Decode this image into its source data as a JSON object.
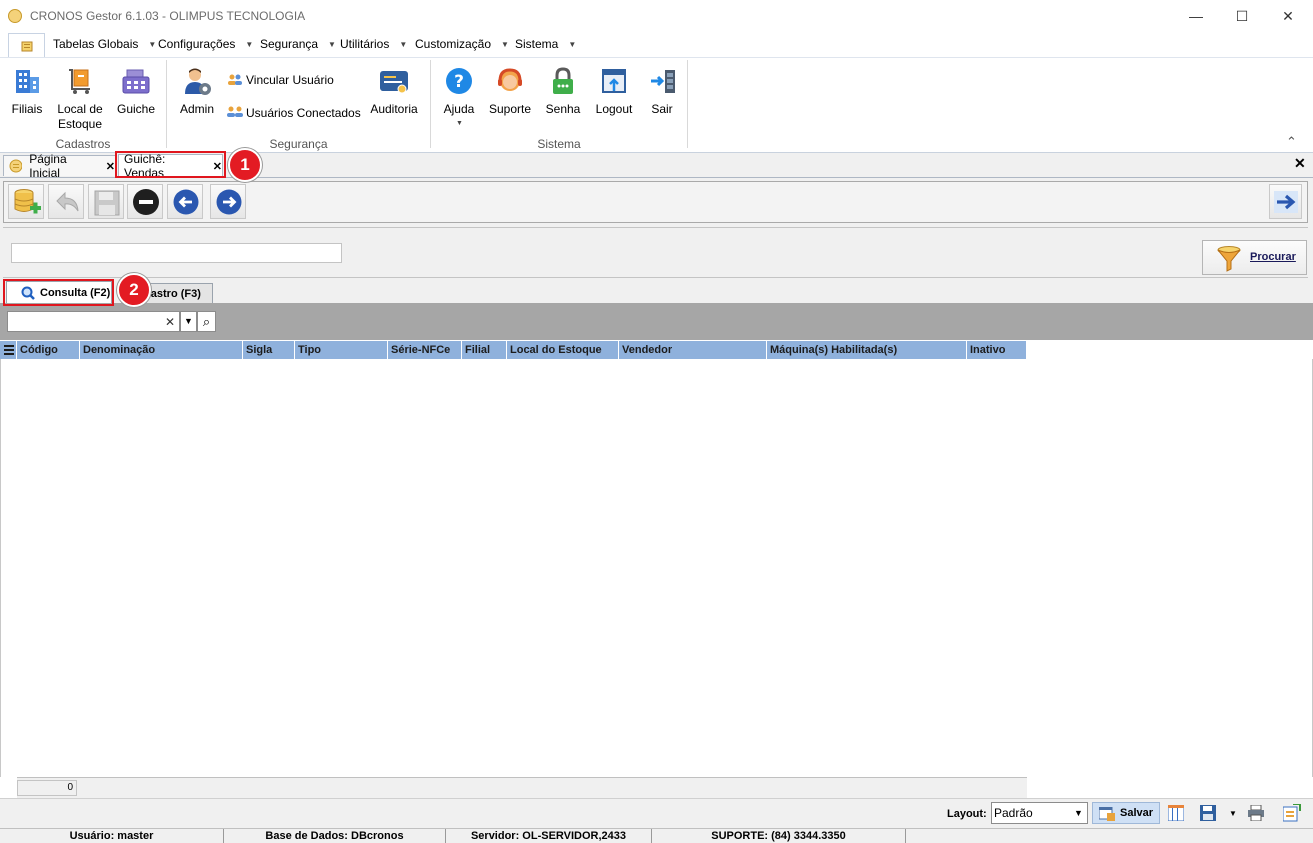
{
  "window": {
    "title": "CRONOS Gestor 6.1.03 - OLIMPUS TECNOLOGIA",
    "minimize": "—",
    "maximize": "☐",
    "close": "✕"
  },
  "menu": [
    {
      "label": "Tabelas Globais"
    },
    {
      "label": "Configurações"
    },
    {
      "label": "Segurança"
    },
    {
      "label": "Utilitários"
    },
    {
      "label": "Customização"
    },
    {
      "label": "Sistema"
    }
  ],
  "menu_arrow": "▼",
  "ribbon": {
    "cadastros": {
      "group_label": "Cadastros",
      "filiais": "Filiais",
      "local_estoque_line1": "Local de",
      "local_estoque_line2": "Estoque",
      "guiche": "Guiche"
    },
    "seguranca": {
      "group_label": "Segurança",
      "admin": "Admin",
      "vincular_usuario": "Vincular Usuário",
      "usuarios_conectados": "Usuários Conectados",
      "auditoria": "Auditoria"
    },
    "sistema": {
      "group_label": "Sistema",
      "ajuda": "Ajuda",
      "suporte": "Suporte",
      "senha": "Senha",
      "logout": "Logout",
      "sair": "Sair"
    },
    "collapse": "⌃"
  },
  "doc_tabs": {
    "home": "Página Inicial",
    "active": "Guichê: Vendas",
    "close_glyph": "✕",
    "close_all": "✕"
  },
  "search": {
    "value": "",
    "procurar": "Procurar"
  },
  "inner_tabs": {
    "consulta": "Consulta (F2)",
    "cadastro": "Cadastro (F3)"
  },
  "filter": {
    "value": "",
    "clear": "✕",
    "dropdown": "▼",
    "search": "⌕"
  },
  "grid": {
    "columns": [
      "Código",
      "Denominação",
      "Sigla",
      "Tipo",
      "Série-NFCe",
      "Filial",
      "Local do Estoque",
      "Vendedor",
      "Máquina(s) Habilitada(s)",
      "Inativo"
    ],
    "rows": [],
    "count": "0"
  },
  "bottom": {
    "layout_label": "Layout:",
    "layout_value": "Padrão",
    "salvar": "Salvar"
  },
  "status": {
    "usuario": "Usuário: master",
    "base": "Base de Dados: DBcronos",
    "servidor": "Servidor: OL-SERVIDOR,2433",
    "suporte": "SUPORTE: (84) 3344.3350"
  },
  "annotations": {
    "one": "1",
    "two": "2"
  },
  "colors": {
    "grid_header": "#8fb1dc",
    "annotation_red": "#e31b23",
    "filter_band": "#a6a6a6"
  }
}
